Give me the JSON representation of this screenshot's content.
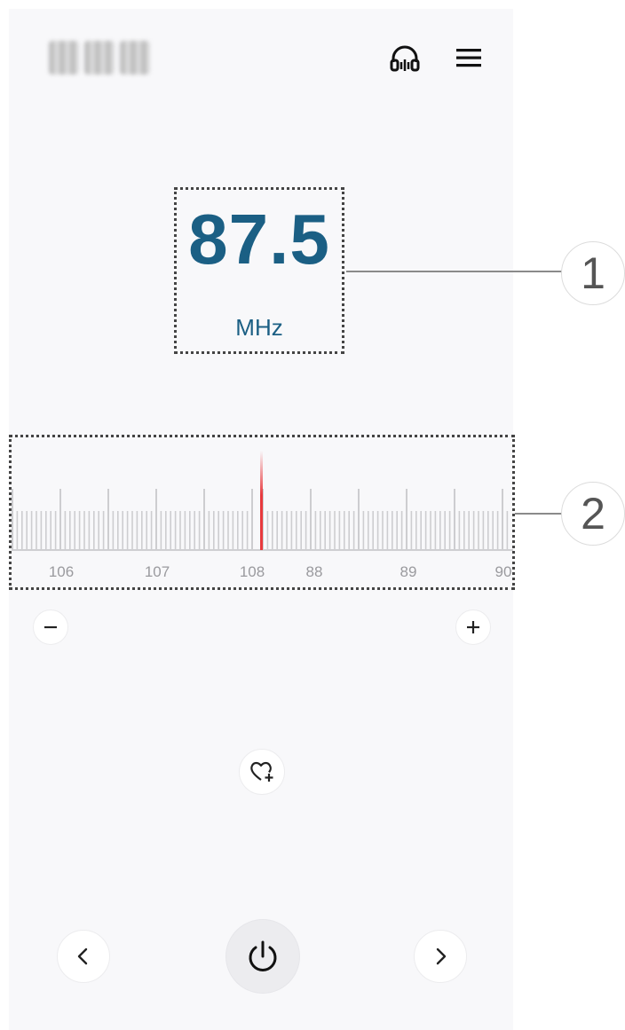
{
  "header": {
    "title": "",
    "headset_icon": "headset-icon",
    "menu_icon": "menu-icon"
  },
  "frequency": {
    "value": "87.5",
    "unit": "MHz"
  },
  "dial": {
    "labels": [
      "106",
      "107",
      "108",
      "88",
      "89",
      "90"
    ],
    "indicator_color": "#e8393d"
  },
  "callouts": [
    "1",
    "2"
  ],
  "controls": {
    "zoom_out_icon": "minus-icon",
    "zoom_in_icon": "plus-icon",
    "favorite_icon": "heart-add-icon",
    "prev_icon": "chevron-left-icon",
    "power_icon": "power-icon",
    "next_icon": "chevron-right-icon"
  },
  "colors": {
    "accent": "#1b5f84",
    "background": "#f8f8fa"
  }
}
